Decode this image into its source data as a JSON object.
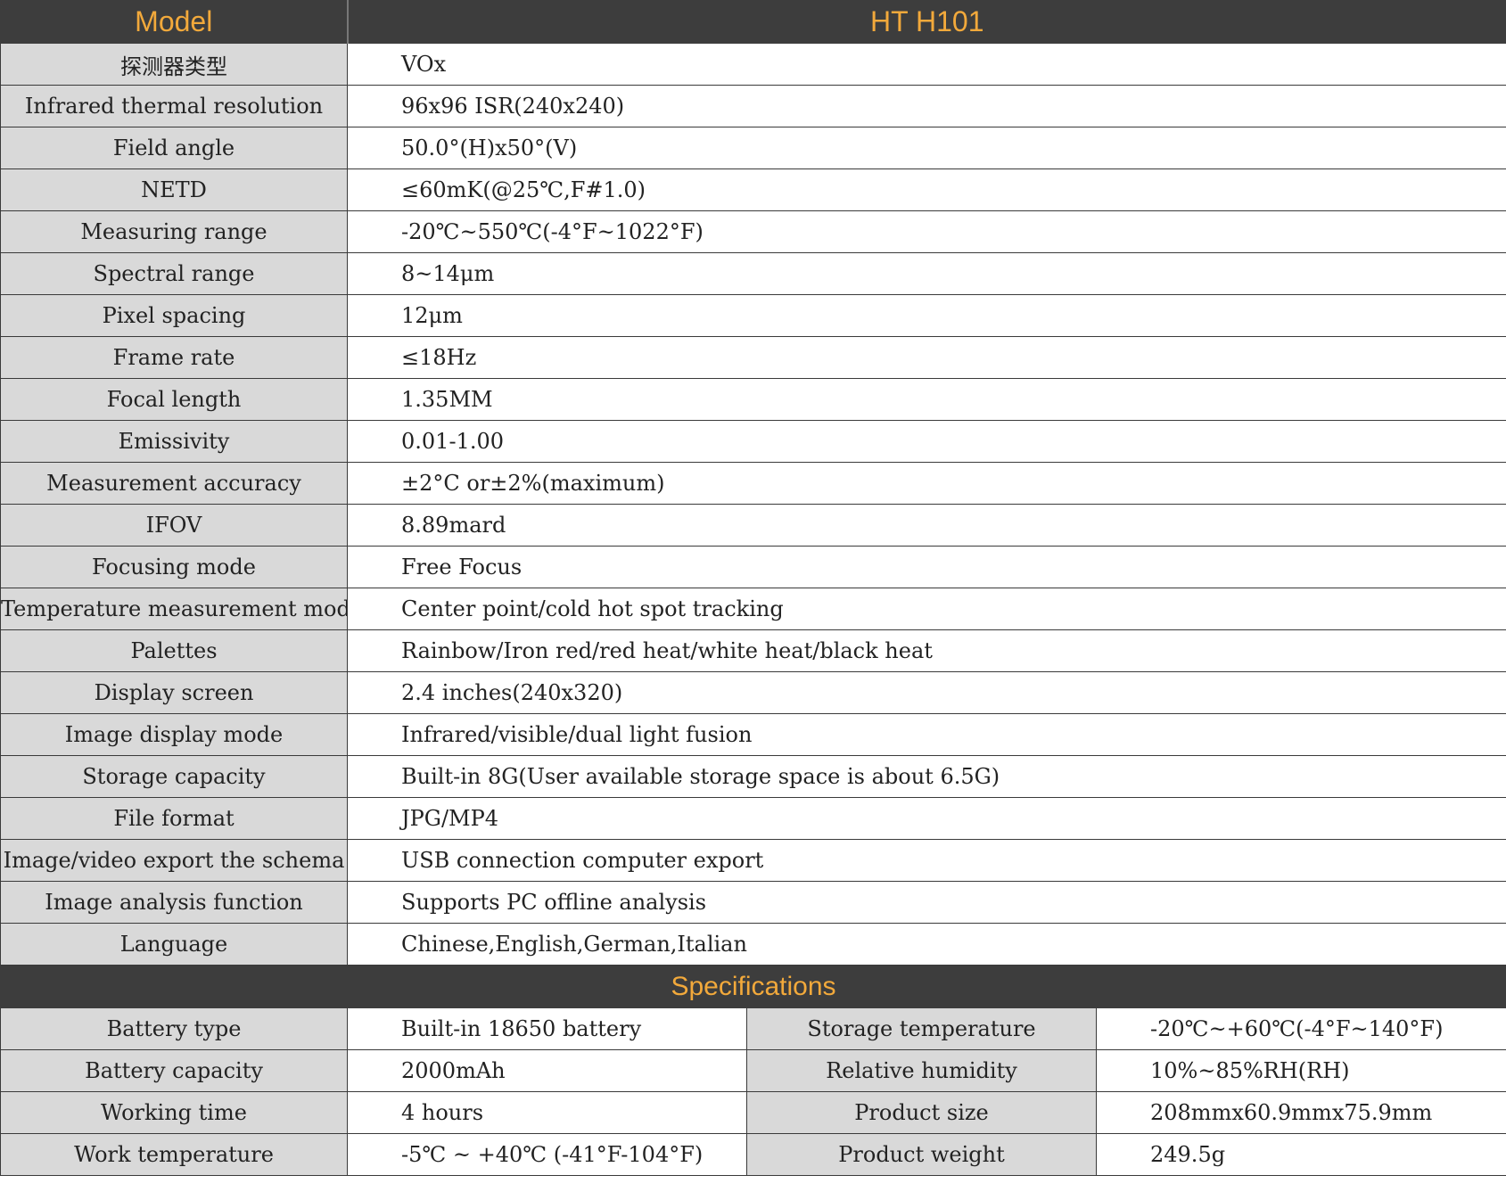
{
  "header": {
    "model_label": "Model",
    "model_value": "HT H101"
  },
  "rows": [
    {
      "label": "探测器类型",
      "value": "VOx"
    },
    {
      "label": "Infrared thermal resolution",
      "value": "96x96 ISR(240x240)"
    },
    {
      "label": "Field angle",
      "value": "50.0°(H)x50°(V)"
    },
    {
      "label": "NETD",
      "value": "≤60mK(@25℃,F#1.0)"
    },
    {
      "label": "Measuring range",
      "value": "-20℃~550℃(-4°F~1022°F)"
    },
    {
      "label": "Spectral range",
      "value": "8~14μm"
    },
    {
      "label": "Pixel spacing",
      "value": "12μm"
    },
    {
      "label": "Frame rate",
      "value": "≤18Hz"
    },
    {
      "label": "Focal length",
      "value": "1.35MM"
    },
    {
      "label": "Emissivity",
      "value": "0.01-1.00"
    },
    {
      "label": "Measurement accuracy",
      "value": "±2°C or±2%(maximum)"
    },
    {
      "label": "IFOV",
      "value": "8.89mard"
    },
    {
      "label": "Focusing mode",
      "value": "Free Focus"
    },
    {
      "label": "Temperature measurement mode",
      "value": "Center point/cold hot spot tracking"
    },
    {
      "label": "Palettes",
      "value": "Rainbow/Iron red/red heat/white heat/black heat"
    },
    {
      "label": "Display screen",
      "value": "2.4 inches(240x320)"
    },
    {
      "label": "Image display mode",
      "value": "Infrared/visible/dual light fusion"
    },
    {
      "label": "Storage capacity",
      "value": "Built-in 8G(User available storage space is about 6.5G)"
    },
    {
      "label": "File format",
      "value": "JPG/MP4"
    },
    {
      "label": "Image/video export the schema",
      "value": "USB connection computer export"
    },
    {
      "label": "Image analysis function",
      "value": "Supports PC offline analysis"
    },
    {
      "label": "Language",
      "value": "Chinese,English,German,Italian"
    }
  ],
  "specifications": {
    "title": "Specifications",
    "rows": [
      {
        "label1": "Battery type",
        "value1": "Built-in 18650 battery",
        "label2": "Storage temperature",
        "value2": "-20℃~+60℃(-4°F~140°F)"
      },
      {
        "label1": "Battery capacity",
        "value1": "2000mAh",
        "label2": "Relative humidity",
        "value2": "10%~85%RH(RH)"
      },
      {
        "label1": "Working time",
        "value1": "4 hours",
        "label2": "Product size",
        "value2": "208mmx60.9mmx75.9mm"
      },
      {
        "label1": "Work temperature",
        "value1": "-5℃ ~ +40℃ (-41°F-104°F)",
        "label2": "Product weight",
        "value2": "249.5g"
      }
    ]
  }
}
